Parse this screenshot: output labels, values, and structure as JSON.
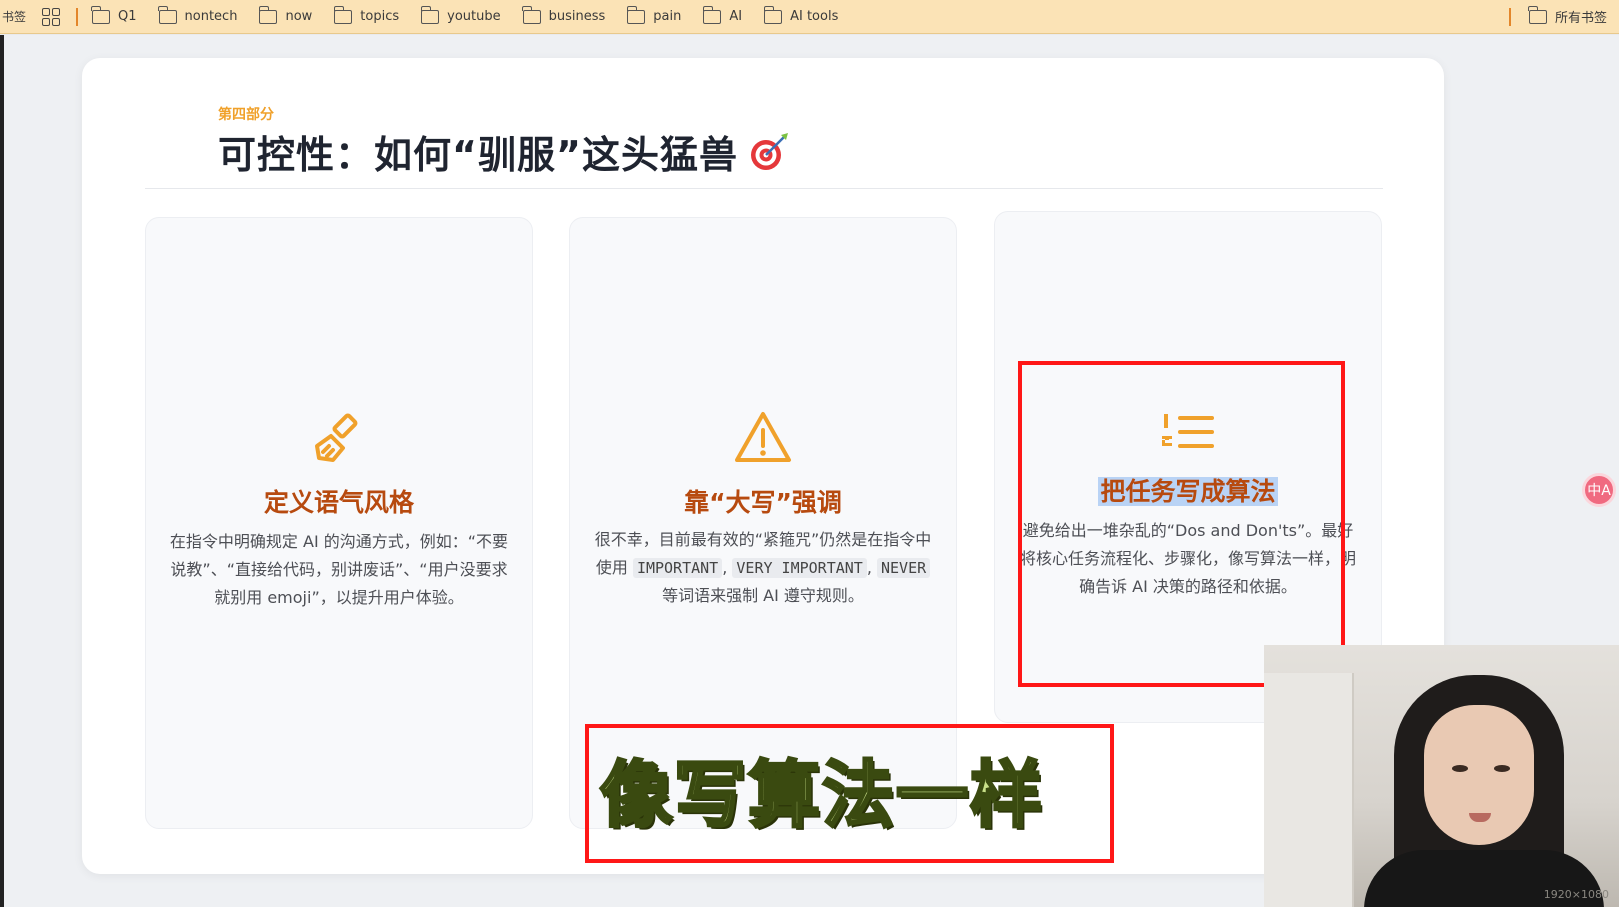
{
  "bookmarks": {
    "label": "书签",
    "items": [
      "Q1",
      "nontech",
      "now",
      "topics",
      "youtube",
      "business",
      "pain",
      "AI",
      "AI tools"
    ],
    "right_item": "所有书签"
  },
  "slide": {
    "eyebrow": "第四部分",
    "title": "可控性：如何“驯服”这头猛兽",
    "title_icon": "target-dart-icon",
    "cards": [
      {
        "icon": "paintbrush-icon",
        "title": "定义语气风格",
        "desc": "在指令中明确规定 AI 的沟通方式，例如：“不要说教”、“直接给代码，别讲废话”、“用户没要求就别用 emoji”，以提升用户体验。"
      },
      {
        "icon": "warning-triangle-icon",
        "title": "靠“大写”强调",
        "desc_before": "很不幸，目前最有效的“紧箍咒”仍然是在指令中使用 ",
        "code1": "IMPORTANT",
        "sep1": ", ",
        "code2": "VERY IMPORTANT",
        "sep2": ", ",
        "code3": "NEVER",
        "desc_after": " 等词语来强制 AI 遵守规则。"
      },
      {
        "icon": "numbered-list-icon",
        "title": "把任务写成算法",
        "desc": "避免给出一堆杂乱的“Dos and Don'ts”。最好将核心任务流程化、步骤化，像写算法一样，明确告诉 AI 决策的路径和依据。"
      }
    ]
  },
  "caption": "像写算法一样",
  "side_button": "中A",
  "webcam": {
    "resolution": "1920×1080"
  },
  "colors": {
    "bookmarks_bg": "#fbe3b6",
    "accent_orange": "#f0a12b",
    "card_title": "#b74a0f",
    "highlight_box": "#ff1717",
    "caption_fill": "#c9e08a"
  }
}
